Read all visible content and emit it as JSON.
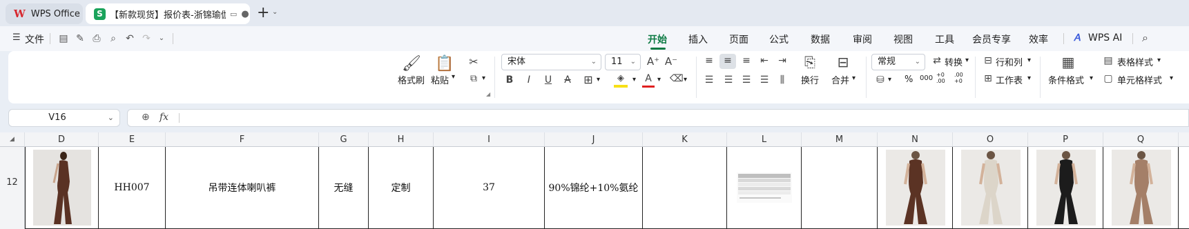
{
  "tabs": {
    "home_label": "WPS Office",
    "doc_title": "【新款现货】报价表-浙锦瑜伽",
    "add_tab": "+"
  },
  "menu": {
    "file_label": "文件",
    "items": [
      "开始",
      "插入",
      "页面",
      "公式",
      "数据",
      "审阅",
      "视图",
      "工具",
      "会员专享",
      "效率"
    ],
    "ai_label": "WPS AI"
  },
  "ribbon": {
    "format_painter": "格式刷",
    "paste": "粘贴",
    "font_name": "宋体",
    "font_size": "11",
    "wrap": "换行",
    "merge": "合并",
    "number_format": "常规",
    "convert": "转换",
    "rows_cols": "行和列",
    "worksheet": "工作表",
    "cond_format": "条件格式",
    "table_style": "表格样式",
    "cell_style": "单元格样式",
    "percent": "%",
    "thousands": "000",
    "inc_decimal": "+0 .00",
    "dec_decimal": ".00 +0"
  },
  "formula_bar": {
    "cell_ref": "V16",
    "fx": "fx",
    "content": ""
  },
  "grid": {
    "columns": [
      "D",
      "E",
      "F",
      "G",
      "H",
      "I",
      "J",
      "K",
      "L",
      "M",
      "N",
      "O",
      "P",
      "Q"
    ],
    "row_number": "12",
    "cells": {
      "E": "HH007",
      "F": "吊带连体喇叭裤",
      "G": "无缝",
      "H": "定制",
      "I": "37",
      "J": "90%锦纶+10%氨纶"
    }
  },
  "colors": {
    "accent": "#0c7a43",
    "wps_red": "#d7282f",
    "sheet_green": "#1aa35b"
  },
  "product_photos": [
    {
      "col": "D",
      "color": "#5a3224"
    },
    {
      "col": "N",
      "color": "#5b3324"
    },
    {
      "col": "O",
      "color": "#dcd5c9"
    },
    {
      "col": "P",
      "color": "#1c1c1c"
    },
    {
      "col": "Q",
      "color": "#a47f68"
    }
  ]
}
